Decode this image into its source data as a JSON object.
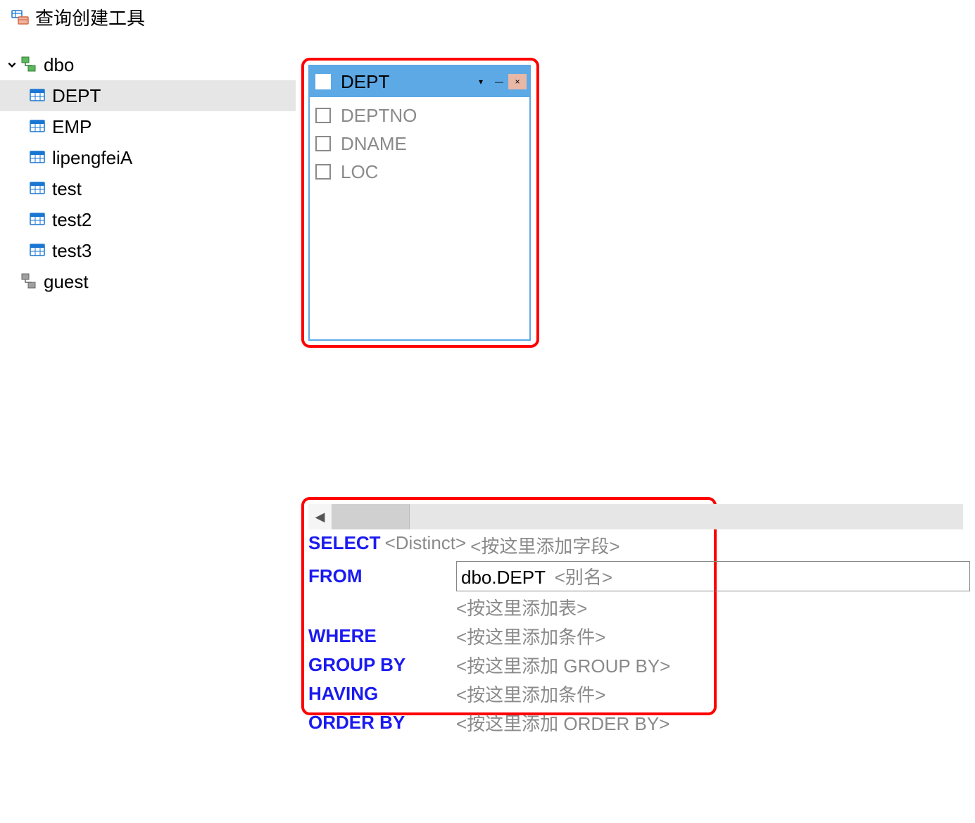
{
  "app": {
    "title": "查询创建工具"
  },
  "tree": {
    "schemas": [
      {
        "name": "dbo",
        "expanded": true,
        "tables": [
          {
            "name": "DEPT",
            "selected": true
          },
          {
            "name": "EMP",
            "selected": false
          },
          {
            "name": "lipengfeiA",
            "selected": false
          },
          {
            "name": "test",
            "selected": false
          },
          {
            "name": "test2",
            "selected": false
          },
          {
            "name": "test3",
            "selected": false
          }
        ]
      },
      {
        "name": "guest",
        "expanded": false,
        "tables": []
      }
    ]
  },
  "table_box": {
    "title": "DEPT",
    "all_checked": false,
    "columns": [
      {
        "name": "DEPTNO",
        "checked": false
      },
      {
        "name": "DNAME",
        "checked": false
      },
      {
        "name": "LOC",
        "checked": false
      }
    ]
  },
  "sql": {
    "keywords": {
      "select": "SELECT",
      "from": "FROM",
      "where": "WHERE",
      "groupby": "GROUP BY",
      "having": "HAVING",
      "orderby": "ORDER BY"
    },
    "distinct_hint": "<Distinct>",
    "add_field_hint": "<按这里添加字段>",
    "from_value": "dbo.DEPT",
    "alias_hint": "<别名>",
    "add_table_hint": "<按这里添加表>",
    "where_hint": "<按这里添加条件>",
    "groupby_hint": "<按这里添加 GROUP BY>",
    "having_hint": "<按这里添加条件>",
    "orderby_hint": "<按这里添加 ORDER BY>"
  }
}
